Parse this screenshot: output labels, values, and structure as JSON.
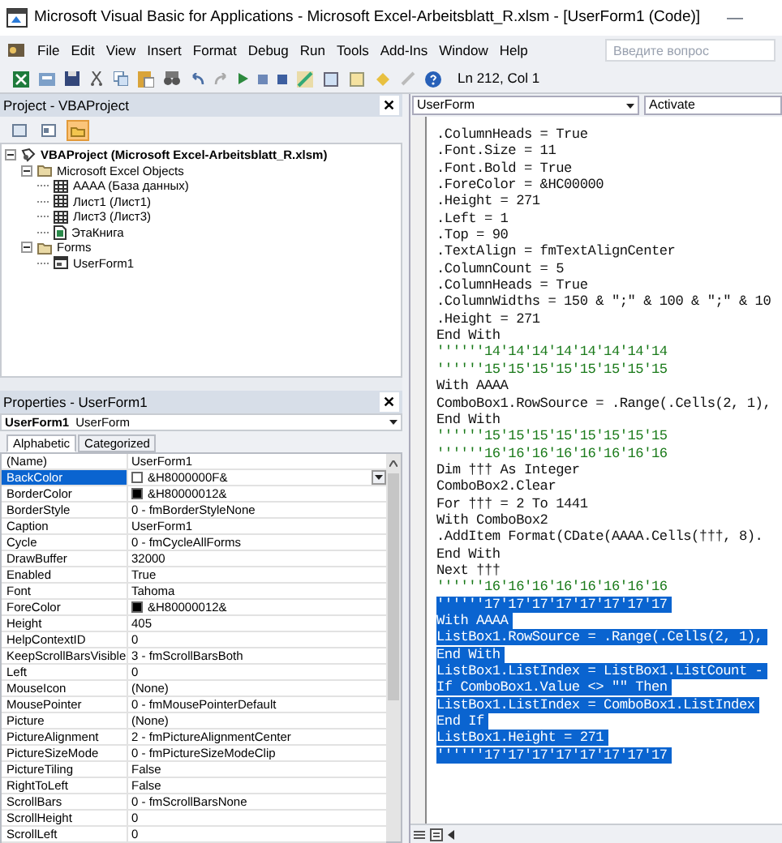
{
  "window": {
    "title": "Microsoft Visual Basic for Applications - Microsoft Excel-Arbeitsblatt_R.xlsm - [UserForm1 (Code)]",
    "minimize": "—"
  },
  "menu": [
    "File",
    "Edit",
    "View",
    "Insert",
    "Format",
    "Debug",
    "Run",
    "Tools",
    "Add-Ins",
    "Window",
    "Help"
  ],
  "help_box": {
    "placeholder": "Введите вопрос"
  },
  "toolbar": {
    "position": "Ln 212, Col 1"
  },
  "project": {
    "title": "Project - VBAProject",
    "close": "✕",
    "buttons": [
      {
        "kind": "view-code",
        "selected": false
      },
      {
        "kind": "view-object",
        "selected": false
      },
      {
        "kind": "toggle-folders",
        "selected": true
      }
    ],
    "tree": [
      {
        "label": "VBAProject (Microsoft Excel-Arbeitsblatt_R.xlsm)",
        "kind": "project",
        "expanded": true,
        "children": [
          {
            "label": "Microsoft Excel Objects",
            "kind": "folder",
            "expanded": true,
            "children": [
              {
                "label": "AAAA (База данных)",
                "kind": "sheet"
              },
              {
                "label": "Лист1 (Лист1)",
                "kind": "sheet"
              },
              {
                "label": "Лист3 (Лист3)",
                "kind": "sheet"
              },
              {
                "label": "ЭтаКнига",
                "kind": "workbook"
              }
            ]
          },
          {
            "label": "Forms",
            "kind": "folder",
            "expanded": true,
            "children": [
              {
                "label": "UserForm1",
                "kind": "form"
              }
            ]
          }
        ]
      }
    ]
  },
  "properties": {
    "title": "Properties - UserForm1",
    "close": "✕",
    "object_name": "UserForm1",
    "object_type": "UserForm",
    "tabs": [
      {
        "label": "Alphabetic",
        "selected": true
      },
      {
        "label": "Categorized",
        "selected": false
      }
    ],
    "rows": [
      {
        "name": "(Name)",
        "value": "UserForm1",
        "selected": false
      },
      {
        "name": "BackColor",
        "value": "&H8000000F&",
        "color": "#ffffff",
        "selected": true
      },
      {
        "name": "BorderColor",
        "value": "&H80000012&",
        "color": "#000000",
        "selected": false
      },
      {
        "name": "BorderStyle",
        "value": "0 - fmBorderStyleNone",
        "selected": false
      },
      {
        "name": "Caption",
        "value": "UserForm1",
        "selected": false
      },
      {
        "name": "Cycle",
        "value": "0 - fmCycleAllForms",
        "selected": false
      },
      {
        "name": "DrawBuffer",
        "value": "32000",
        "selected": false
      },
      {
        "name": "Enabled",
        "value": "True",
        "selected": false
      },
      {
        "name": "Font",
        "value": "Tahoma",
        "selected": false
      },
      {
        "name": "ForeColor",
        "value": "&H80000012&",
        "color": "#000000",
        "selected": false
      },
      {
        "name": "Height",
        "value": "405",
        "selected": false
      },
      {
        "name": "HelpContextID",
        "value": "0",
        "selected": false
      },
      {
        "name": "KeepScrollBarsVisible",
        "value": "3 - fmScrollBarsBoth",
        "selected": false
      },
      {
        "name": "Left",
        "value": "0",
        "selected": false
      },
      {
        "name": "MouseIcon",
        "value": "(None)",
        "selected": false
      },
      {
        "name": "MousePointer",
        "value": "0 - fmMousePointerDefault",
        "selected": false
      },
      {
        "name": "Picture",
        "value": "(None)",
        "selected": false
      },
      {
        "name": "PictureAlignment",
        "value": "2 - fmPictureAlignmentCenter",
        "selected": false
      },
      {
        "name": "PictureSizeMode",
        "value": "0 - fmPictureSizeModeClip",
        "selected": false
      },
      {
        "name": "PictureTiling",
        "value": "False",
        "selected": false
      },
      {
        "name": "RightToLeft",
        "value": "False",
        "selected": false
      },
      {
        "name": "ScrollBars",
        "value": "0 - fmScrollBarsNone",
        "selected": false
      },
      {
        "name": "ScrollHeight",
        "value": "0",
        "selected": false
      },
      {
        "name": "ScrollLeft",
        "value": "0",
        "selected": false
      }
    ]
  },
  "code": {
    "object": "UserForm",
    "procedure": "Activate",
    "lines": [
      {
        "text": ".ColumnHeads = True",
        "kind": "code",
        "selected": false
      },
      {
        "text": ".Font.Size = 11",
        "kind": "code",
        "selected": false
      },
      {
        "text": ".Font.Bold = True",
        "kind": "code",
        "selected": false
      },
      {
        "text": ".ForeColor = &HC00000",
        "kind": "code",
        "selected": false
      },
      {
        "text": ".Height = 271",
        "kind": "code",
        "selected": false
      },
      {
        "text": ".Left = 1",
        "kind": "code",
        "selected": false
      },
      {
        "text": ".Top = 90",
        "kind": "code",
        "selected": false
      },
      {
        "text": ".TextAlign = fmTextAlignCenter",
        "kind": "code",
        "selected": false
      },
      {
        "text": ".ColumnCount = 5",
        "kind": "code",
        "selected": false
      },
      {
        "text": ".ColumnHeads = True",
        "kind": "code",
        "selected": false
      },
      {
        "text": ".ColumnWidths = 150 & \";\" & 100 & \";\" & 10",
        "kind": "code",
        "selected": false
      },
      {
        "text": ".Height = 271",
        "kind": "code",
        "selected": false
      },
      {
        "text": "End With",
        "kind": "code",
        "selected": false
      },
      {
        "text": "''''''14'14'14'14'14'14'14'14",
        "kind": "comment",
        "selected": false
      },
      {
        "text": "''''''15'15'15'15'15'15'15'15",
        "kind": "comment",
        "selected": false
      },
      {
        "text": "With AAAA",
        "kind": "code",
        "selected": false
      },
      {
        "text": "ComboBox1.RowSource = .Range(.Cells(2, 1),",
        "kind": "code",
        "selected": false
      },
      {
        "text": "End With",
        "kind": "code",
        "selected": false
      },
      {
        "text": "''''''15'15'15'15'15'15'15'15",
        "kind": "comment",
        "selected": false
      },
      {
        "text": "''''''16'16'16'16'16'16'16'16",
        "kind": "comment",
        "selected": false
      },
      {
        "text": "Dim ††† As Integer",
        "kind": "code",
        "selected": false
      },
      {
        "text": "ComboBox2.Clear",
        "kind": "code",
        "selected": false
      },
      {
        "text": "For ††† = 2 To 1441",
        "kind": "code",
        "selected": false
      },
      {
        "text": "With ComboBox2",
        "kind": "code",
        "selected": false
      },
      {
        "text": ".AddItem Format(CDate(AAAA.Cells(†††, 8).",
        "kind": "code",
        "selected": false
      },
      {
        "text": "End With",
        "kind": "code",
        "selected": false
      },
      {
        "text": "Next †††",
        "kind": "code",
        "selected": false
      },
      {
        "text": "''''''16'16'16'16'16'16'16'16",
        "kind": "comment",
        "selected": false
      },
      {
        "text": "''''''17'17'17'17'17'17'17'17",
        "kind": "comment",
        "selected": true
      },
      {
        "text": "With AAAA",
        "kind": "code",
        "selected": true
      },
      {
        "text": "ListBox1.RowSource = .Range(.Cells(2, 1),",
        "kind": "code",
        "selected": true
      },
      {
        "text": "End With",
        "kind": "code",
        "selected": true
      },
      {
        "text": "ListBox1.ListIndex = ListBox1.ListCount -",
        "kind": "code",
        "selected": true
      },
      {
        "text": "If ComboBox1.Value <> \"\" Then",
        "kind": "code",
        "selected": true
      },
      {
        "text": "ListBox1.ListIndex = ComboBox1.ListIndex",
        "kind": "code",
        "selected": true
      },
      {
        "text": "End If",
        "kind": "code",
        "selected": true
      },
      {
        "text": "ListBox1.Height = 271",
        "kind": "code",
        "selected": true
      },
      {
        "text": "''''''17'17'17'17'17'17'17'17",
        "kind": "comment",
        "selected": true
      }
    ]
  }
}
